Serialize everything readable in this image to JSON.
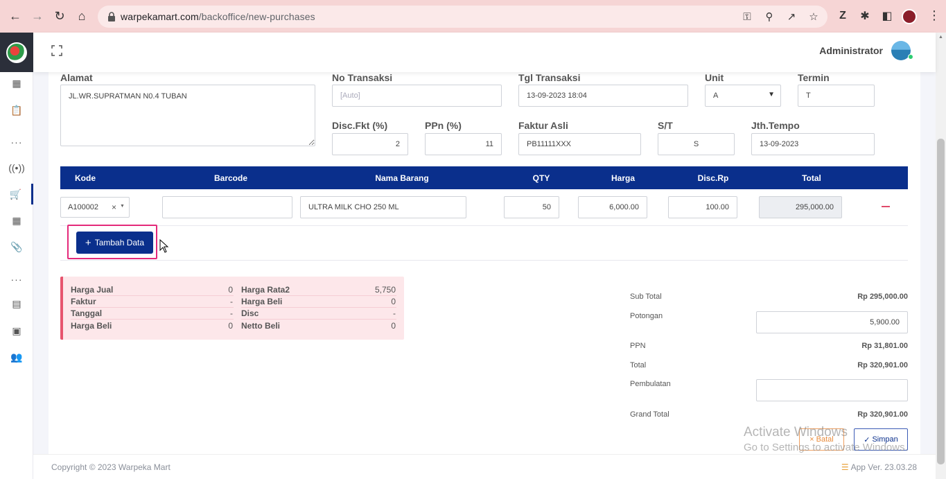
{
  "browser": {
    "url_host": "warpekamart.com",
    "url_path": "/backoffice/new-purchases"
  },
  "header": {
    "user_name": "Administrator"
  },
  "form": {
    "alamat_label": "Alamat",
    "alamat_value": "JL.WR.SUPRATMAN N0.4 TUBAN",
    "no_transaksi_label": "No Transaksi",
    "no_transaksi_placeholder": "[Auto]",
    "tgl_transaksi_label": "Tgl Transaksi",
    "tgl_transaksi_value": "13-09-2023 18:04",
    "unit_label": "Unit",
    "unit_value": "A",
    "termin_label": "Termin",
    "termin_value": "T",
    "disc_fkt_label": "Disc.Fkt (%)",
    "disc_fkt_value": "2",
    "ppn_label": "PPn (%)",
    "ppn_value": "11",
    "faktur_asli_label": "Faktur Asli",
    "faktur_asli_value": "PB11111XXX",
    "st_label": "S/T",
    "st_value": "S",
    "jth_tempo_label": "Jth.Tempo",
    "jth_tempo_value": "13-09-2023"
  },
  "table": {
    "headers": {
      "kode": "Kode",
      "barcode": "Barcode",
      "nama": "Nama Barang",
      "qty": "QTY",
      "harga": "Harga",
      "disc": "Disc.Rp",
      "total": "Total"
    },
    "rows": [
      {
        "kode": "A100002",
        "barcode": "",
        "nama": "ULTRA MILK CHO 250 ML",
        "qty": "50",
        "harga": "6,000.00",
        "disc": "100.00",
        "total": "295,000.00"
      }
    ],
    "add_button": "Tambah Data"
  },
  "info": {
    "harga_jual_label": "Harga Jual",
    "harga_jual_value": "0",
    "faktur_label": "Faktur",
    "faktur_value": "-",
    "tanggal_label": "Tanggal",
    "tanggal_value": "-",
    "harga_beli_label": "Harga Beli",
    "harga_beli_value": "0",
    "harga_rata2_label": "Harga Rata2",
    "harga_rata2_value": "5,750",
    "harga_beli2_label": "Harga Beli",
    "harga_beli2_value": "0",
    "disc_label": "Disc",
    "disc_value": "-",
    "netto_beli_label": "Netto Beli",
    "netto_beli_value": "0"
  },
  "totals": {
    "sub_total_label": "Sub Total",
    "sub_total_value": "Rp 295,000.00",
    "potongan_label": "Potongan",
    "potongan_value": "5,900.00",
    "ppn_label": "PPN",
    "ppn_value": "Rp 31,801.00",
    "total_label": "Total",
    "total_value": "Rp 320,901.00",
    "pembulatan_label": "Pembulatan",
    "pembulatan_value": "",
    "grand_total_label": "Grand Total",
    "grand_total_value": "Rp 320,901.00"
  },
  "actions": {
    "batal": "Batal",
    "simpan": "Simpan"
  },
  "watermark": {
    "line1": "Activate Windows",
    "line2": "Go to Settings to activate Windows."
  },
  "footer": {
    "copyright": "Copyright © 2023 Warpeka Mart",
    "version": "App Ver. 23.03.28"
  },
  "colors": {
    "primary": "#0a2f8c",
    "highlight": "#e4297a",
    "info_bg": "#fde7ea",
    "chrome_bg": "#f6d5d5"
  }
}
